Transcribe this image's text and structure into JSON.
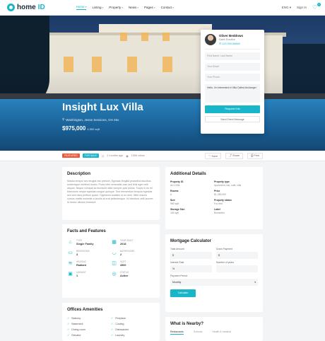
{
  "header": {
    "logo_prefix": "home",
    "logo_suffix": "ID",
    "nav": [
      "Home",
      "Listing",
      "Property",
      "News",
      "Pages",
      "Contact"
    ],
    "lang": "ENG",
    "signin": "Sign In",
    "fav_count": "1"
  },
  "hero": {
    "title": "Insight Lux Villa",
    "address": "Washington, Jesse Sessions, OH 45x",
    "price": "$975,000",
    "price_suffix": "4,500 sqft"
  },
  "agent": {
    "name": "Oliver Beddows",
    "role": "Sales Excutive",
    "phone": "123 900 68668",
    "name_placeholder": "First Name, Last Name",
    "email_placeholder": "Your Email",
    "phone_placeholder": "Your Phone",
    "message": "Hello, I'm interested in Villa Called Archangel",
    "request_btn": "Request Info",
    "send_btn": "Send Direct Message"
  },
  "meta": {
    "tag_featured": "FEATURED",
    "tag_sale": "FOR SALE",
    "time": "2 months ago",
    "views": "1556 views",
    "actions": [
      "Save",
      "Share",
      "Print"
    ]
  },
  "description": {
    "title": "Description",
    "text": "Massa tempor nec feugiat nisl pretium. Egestas fringilla phasellus faucibus scelerisque eleifend donec. Porta nibh venenatis cras sed felis eget velit aliquet. Neque volutpat ac tincidunt vitae semper quis lectus. Turpis in eu mi bibendum neque egestas congue quisque. Sed elementum tempus egestas sed sed risus pretium quam. Dignissim sodales ut eu sem. Nibh mauris cursus mattis molestie a iaculis at erat pellentesque. Id interdum velit laoreet id donec ultrices tincidunt."
  },
  "facts": {
    "title": "Facts and Features",
    "items": [
      {
        "icon": "home-icon",
        "glyph": "⌂",
        "label": "TYPE",
        "value": "Single Family"
      },
      {
        "icon": "calendar-icon",
        "glyph": "▦",
        "label": "YEAR BUILT",
        "value": "2018"
      },
      {
        "icon": "bed-icon",
        "glyph": "▭",
        "label": "BEDROOMS",
        "value": "3"
      },
      {
        "icon": "bath-icon",
        "glyph": "◡",
        "label": "BATHROOMS",
        "value": "2"
      },
      {
        "icon": "heating-icon",
        "glyph": "≋",
        "label": "HEATING",
        "value": "Radiant"
      },
      {
        "icon": "size-icon",
        "glyph": "◫",
        "label": "SQFT",
        "value": "4500"
      },
      {
        "icon": "garage-icon",
        "glyph": "▣",
        "label": "GARAGE",
        "value": "1"
      },
      {
        "icon": "status-icon",
        "glyph": "◎",
        "label": "STATUS",
        "value": "Active"
      }
    ]
  },
  "amenities": {
    "title": "Offices Amenities",
    "items": [
      "Balcony",
      "Fireplace",
      "Basement",
      "Cooling",
      "Dining room",
      "Dishwasher",
      "Elevator",
      "Laundry"
    ]
  },
  "details": {
    "title": "Additional Details",
    "items": [
      {
        "label": "Property ID",
        "value": "AD-1308"
      },
      {
        "label": "Property type",
        "value": "Apartment, bar, cafe, villa"
      },
      {
        "label": "Rooms",
        "value": "6"
      },
      {
        "label": "Price",
        "value": "$1,250,000"
      },
      {
        "label": "Size",
        "value": "980 sqft"
      },
      {
        "label": "Property status",
        "value": "For rent"
      },
      {
        "label": "Storage Size",
        "value": "150 sqft"
      },
      {
        "label": "Label",
        "value": "Bestseller"
      }
    ]
  },
  "mortgage": {
    "title": "Mortgage Calculator",
    "total_label": "Total Amount",
    "total_value": "$",
    "down_label": "Down Payment",
    "down_value": "$",
    "rate_label": "Interest Rate",
    "rate_value": "%",
    "years_label": "Number of years",
    "years_value": "",
    "period_label": "Payment Period",
    "period_value": "Monthly",
    "calc_btn": "Calculate"
  },
  "nearby": {
    "title": "What is Nearby?",
    "tabs": [
      "Restaurants",
      "Schools",
      "Health & medical"
    ]
  }
}
